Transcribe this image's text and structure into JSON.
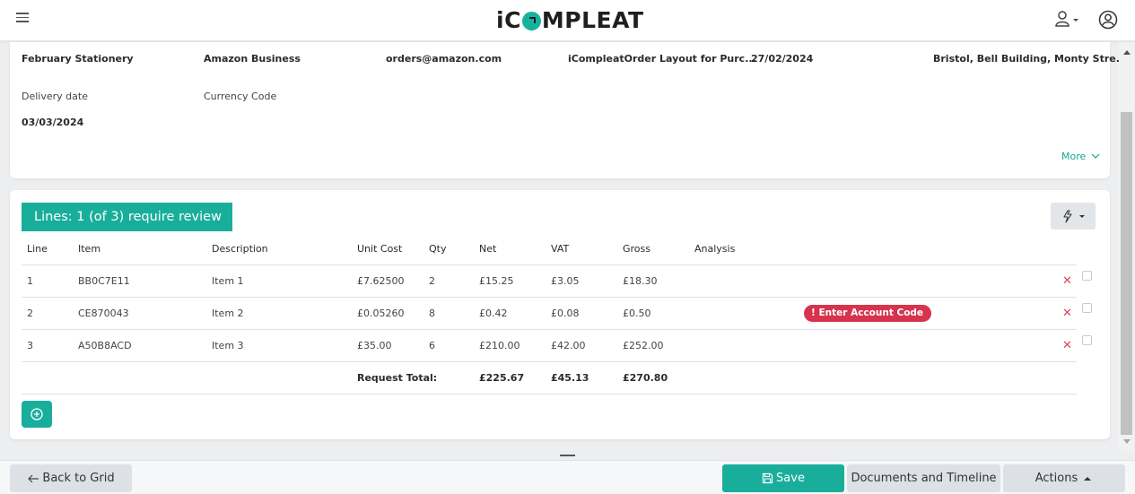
{
  "app": {
    "logo_text_before": "iC",
    "logo_text_after": "MPLEAT",
    "brand_color": "#19ae9b"
  },
  "header": {
    "values": [
      "February Stationery",
      "Amazon Business",
      "orders@amazon.com",
      "iCompleatOrder Layout for Purc...",
      "27/02/2024",
      "Bristol, Bell Building, Monty Stre..."
    ],
    "delivery_date_label": "Delivery date",
    "currency_code_label": "Currency Code",
    "delivery_date_value": "03/03/2024",
    "more_label": "More"
  },
  "lines": {
    "review_banner": "Lines: 1 (of 3) require review",
    "columns": [
      "Line",
      "Item",
      "Description",
      "Unit Cost",
      "Qty",
      "Net",
      "VAT",
      "Gross",
      "Analysis"
    ],
    "rows": [
      {
        "line": "1",
        "item": "BB0C7E11",
        "description": "Item 1",
        "unit_cost": "£7.62500",
        "qty": "2",
        "net": "£15.25",
        "vat": "£3.05",
        "gross": "£18.30",
        "analysis": ""
      },
      {
        "line": "2",
        "item": "CE870043",
        "description": "Item 2",
        "unit_cost": "£0.05260",
        "qty": "8",
        "net": "£0.42",
        "vat": "£0.08",
        "gross": "£0.50",
        "analysis": "Enter Account Code"
      },
      {
        "line": "3",
        "item": "A50B8ACD",
        "description": "Item 3",
        "unit_cost": "£35.00",
        "qty": "6",
        "net": "£210.00",
        "vat": "£42.00",
        "gross": "£252.00",
        "analysis": ""
      }
    ],
    "total": {
      "label": "Request Total:",
      "net": "£225.67",
      "vat": "£45.13",
      "gross": "£270.80"
    },
    "alert_color": "#d6344d"
  },
  "footer": {
    "back_label": "Back to Grid",
    "save_label": "Save",
    "documents_label": "Documents and Timeline",
    "actions_label": "Actions"
  }
}
